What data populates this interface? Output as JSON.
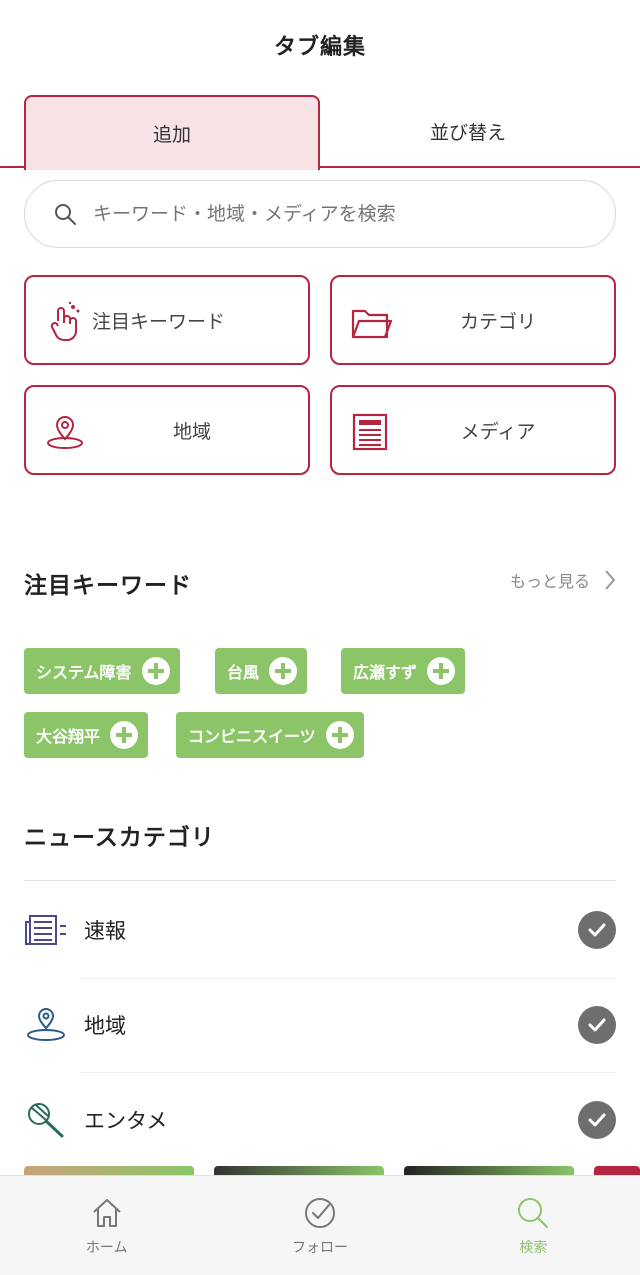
{
  "header": {
    "title": "タブ編集"
  },
  "tabs": {
    "add": "追加",
    "reorder": "並び替え"
  },
  "search": {
    "placeholder": "キーワード・地域・メディアを検索"
  },
  "grid": {
    "keyword": "注目キーワード",
    "category": "カテゴリ",
    "region": "地域",
    "media": "メディア"
  },
  "keywords_section": {
    "title": "注目キーワード",
    "more": "もっと見る",
    "chips": [
      "システム障害",
      "台風",
      "広瀬すず",
      "大谷翔平",
      "コンビニスイーツ"
    ]
  },
  "category_section": {
    "title": "ニュースカテゴリ",
    "items": [
      {
        "label": "速報",
        "icon": "news-icon"
      },
      {
        "label": "地域",
        "icon": "map-pin-icon"
      },
      {
        "label": "エンタメ",
        "icon": "microphone-icon"
      }
    ]
  },
  "bottom_nav": {
    "home": "ホーム",
    "follow": "フォロー",
    "search": "検索"
  },
  "colors": {
    "accent": "#b5253f",
    "chip": "#8bc568",
    "tab_active_bg": "#f7e3e6",
    "check": "#6e6e6e"
  }
}
